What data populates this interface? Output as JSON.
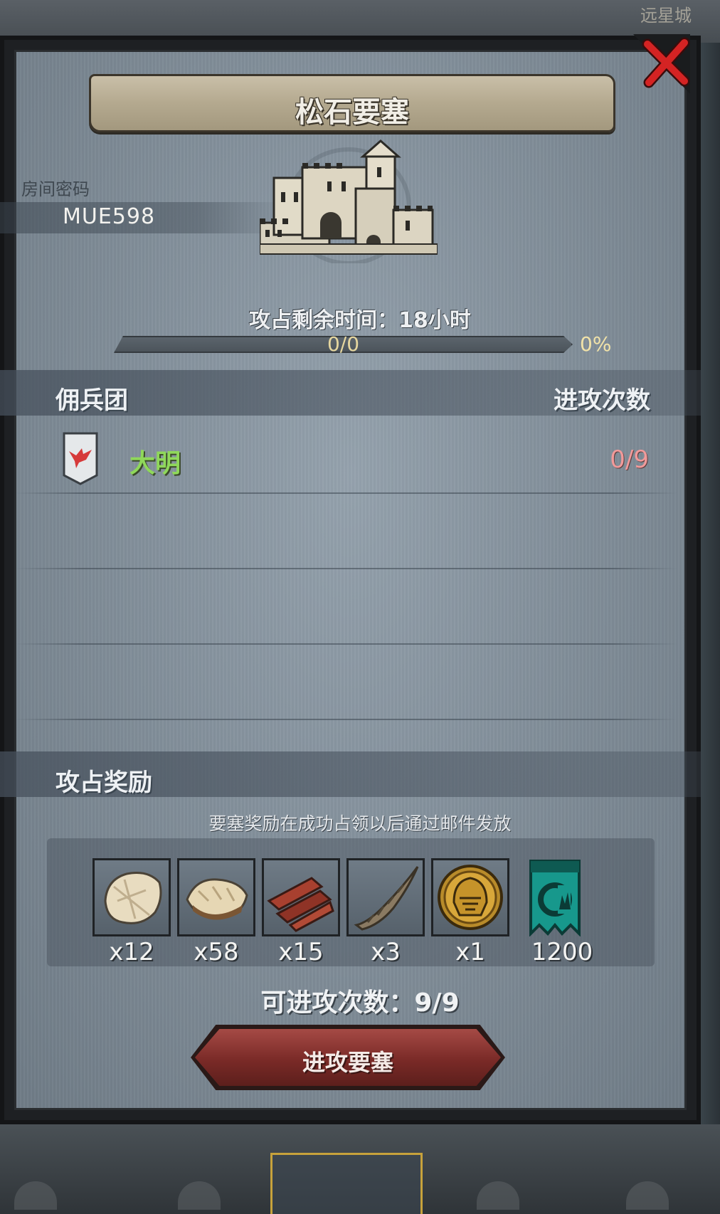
{
  "background": {
    "top_label": "远星城"
  },
  "dialog": {
    "title": "松石要塞",
    "room": {
      "label": "房间密码",
      "code": "MUE598"
    },
    "timer": {
      "text": "攻占剩余时间：18小时"
    },
    "progress": {
      "label": "0/0",
      "percent": "0%",
      "value": 0
    },
    "mercenary_section": {
      "title": "佣兵团",
      "column_attacks": "进攻次数",
      "rows": [
        {
          "name": "大明",
          "attacks": "0/9",
          "flag_color": "#d63a3a"
        }
      ]
    },
    "rewards_section": {
      "title": "攻占奖励",
      "note": "要塞奖励在成功占领以后通过邮件发放",
      "items": [
        {
          "icon": "fur-pelt-icon",
          "qty": "x12"
        },
        {
          "icon": "wool-fleece-icon",
          "qty": "x58"
        },
        {
          "icon": "timber-planks-icon",
          "qty": "x15"
        },
        {
          "icon": "twisted-horn-icon",
          "qty": "x3"
        },
        {
          "icon": "golden-helmet-icon",
          "qty": "x1"
        },
        {
          "icon": "teal-banner-icon",
          "qty": "1200"
        }
      ]
    },
    "attack_count": "可进攻次数：9/9",
    "attack_button": "进攻要塞"
  },
  "colors": {
    "accent_green": "#8fd85a",
    "attack_red": "#7a2a27",
    "count_pink": "#f19a9a",
    "close_red": "#d42323"
  }
}
